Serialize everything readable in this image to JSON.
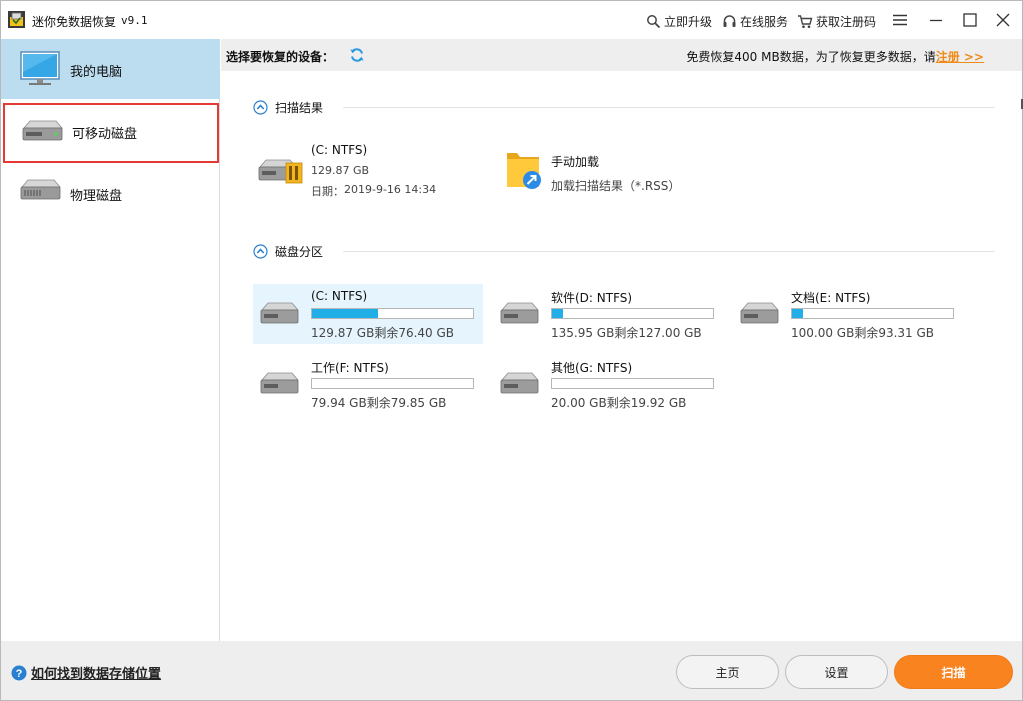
{
  "window": {
    "title": "迷你免数据恢复",
    "version": "v9.1",
    "links": {
      "upgrade": "立即升级",
      "online_service": "在线服务",
      "get_code": "获取注册码"
    }
  },
  "sidebar": {
    "items": [
      {
        "label": "我的电脑",
        "icon": "monitor-icon"
      },
      {
        "label": "可移动磁盘",
        "icon": "removable-disk-icon"
      },
      {
        "label": "物理磁盘",
        "icon": "physical-disk-icon"
      }
    ]
  },
  "devbar": {
    "label": "选择要恢复的设备：",
    "notice": "免费恢复400 MB数据，为了恢复更多数据，请",
    "notice_link": "注册 >>"
  },
  "scan_results": {
    "title": "扫描结果",
    "items": [
      {
        "name": "(C: NTFS)",
        "size": "129.87 GB",
        "date_label": "日期：",
        "date": "2019-9-16 14:34"
      },
      {
        "name": "手动加载",
        "sub": "加载扫描结果（*.RSS）"
      }
    ]
  },
  "partitions": {
    "title": "磁盘分区",
    "items": [
      {
        "name": "(C: NTFS)",
        "info": "129.87 GB剩余76.40 GB",
        "used_fraction": 0.41,
        "selected": true
      },
      {
        "name": "软件(D: NTFS)",
        "info": "135.95 GB剩余127.00 GB",
        "used_fraction": 0.07,
        "selected": false
      },
      {
        "name": "文档(E: NTFS)",
        "info": "100.00 GB剩余93.31 GB",
        "used_fraction": 0.07,
        "selected": false
      },
      {
        "name": "工作(F: NTFS)",
        "info": "79.94 GB剩余79.85 GB",
        "used_fraction": 0.0,
        "selected": false
      },
      {
        "name": "其他(G: NTFS)",
        "info": "20.00 GB剩余19.92 GB",
        "used_fraction": 0.0,
        "selected": false
      }
    ]
  },
  "footer": {
    "help": "如何找到数据存储位置",
    "home": "主页",
    "settings": "设置",
    "scan": "扫描"
  },
  "colors": {
    "accent": "#22aee6",
    "selected_bg": "#bcdcf0",
    "scan_button": "#f9831f",
    "highlight_border": "#e53935"
  }
}
